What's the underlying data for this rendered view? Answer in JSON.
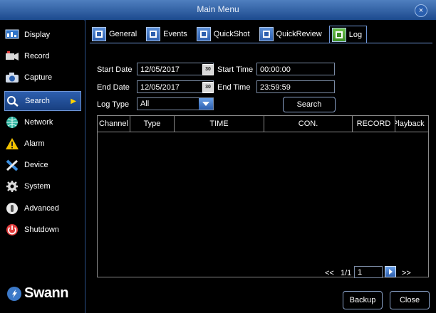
{
  "window": {
    "title": "Main Menu",
    "close_label": "×"
  },
  "sidebar": {
    "items": [
      {
        "label": "Display",
        "icon": "display-icon"
      },
      {
        "label": "Record",
        "icon": "record-icon"
      },
      {
        "label": "Capture",
        "icon": "capture-icon"
      },
      {
        "label": "Search",
        "icon": "search-icon",
        "active": true
      },
      {
        "label": "Network",
        "icon": "network-icon"
      },
      {
        "label": "Alarm",
        "icon": "alarm-icon"
      },
      {
        "label": "Device",
        "icon": "device-icon"
      },
      {
        "label": "System",
        "icon": "system-icon"
      },
      {
        "label": "Advanced",
        "icon": "advanced-icon"
      },
      {
        "label": "Shutdown",
        "icon": "shutdown-icon"
      }
    ],
    "brand": "Swann"
  },
  "tabs": [
    {
      "label": "General"
    },
    {
      "label": "Events"
    },
    {
      "label": "QuickShot"
    },
    {
      "label": "QuickReview"
    },
    {
      "label": "Log",
      "active": true
    }
  ],
  "form": {
    "start_date_label": "Start Date",
    "start_date_value": "12/05/2017",
    "start_time_label": "Start Time",
    "start_time_value": "00:00:00",
    "end_date_label": "End Date",
    "end_date_value": "12/05/2017",
    "end_time_label": "End Time",
    "end_time_value": "23:59:59",
    "log_type_label": "Log Type",
    "log_type_value": "All",
    "search_button": "Search",
    "calendar_icon_text": "30"
  },
  "table": {
    "columns": [
      "Channel",
      "Type",
      "TIME",
      "CON.",
      "RECORD",
      "Playback"
    ],
    "rows": []
  },
  "pager": {
    "prev": "<<",
    "page_text": "1/1",
    "page_input": "1",
    "next": ">>"
  },
  "footer": {
    "backup_button": "Backup",
    "close_button": "Close"
  },
  "colors": {
    "accent": "#2d5fae",
    "title_bar": "#1c4a8e",
    "active_tab_icon": "#3d8c24"
  }
}
